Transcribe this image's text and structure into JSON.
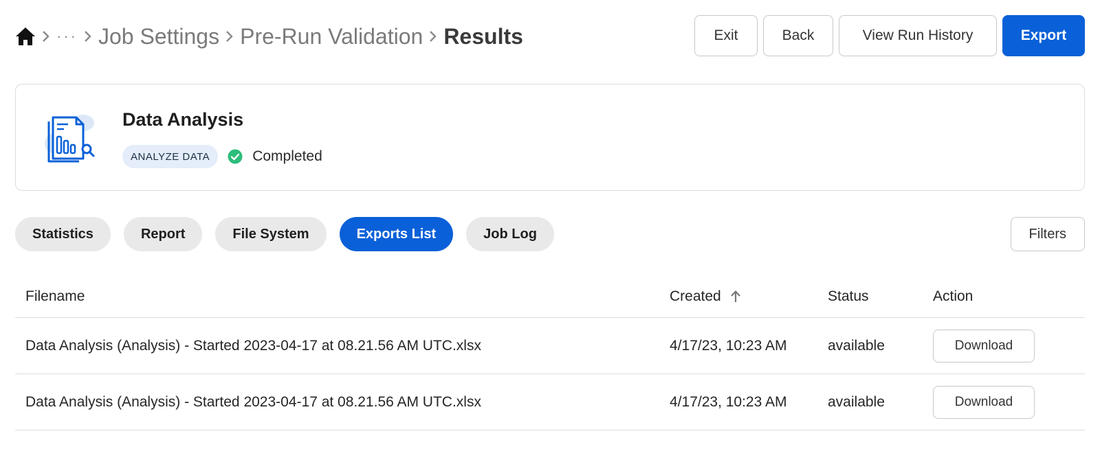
{
  "breadcrumb": {
    "home_icon": "home-icon",
    "ellipsis": "···",
    "items": [
      "Job Settings",
      "Pre-Run Validation"
    ],
    "current": "Results"
  },
  "top_actions": {
    "exit": "Exit",
    "back": "Back",
    "view_run_history": "View Run History",
    "export": "Export"
  },
  "job": {
    "icon": "data-report-icon",
    "title": "Data Analysis",
    "type_tag": "ANALYZE DATA",
    "status_icon": "check-circle-icon",
    "status": "Completed"
  },
  "tabs": [
    {
      "label": "Statistics",
      "active": false
    },
    {
      "label": "Report",
      "active": false
    },
    {
      "label": "File System",
      "active": false
    },
    {
      "label": "Exports List",
      "active": true
    },
    {
      "label": "Job Log",
      "active": false
    }
  ],
  "filters_label": "Filters",
  "table": {
    "columns": {
      "filename": "Filename",
      "created": "Created",
      "status": "Status",
      "action": "Action"
    },
    "sort": {
      "column": "created",
      "direction": "ascending",
      "icon": "arrow-up-icon"
    },
    "rows": [
      {
        "filename": "Data Analysis (Analysis) - Started 2023-04-17 at 08.21.56 AM UTC.xlsx",
        "created": "4/17/23, 10:23 AM",
        "status": "available",
        "action": "Download"
      },
      {
        "filename": "Data Analysis (Analysis) - Started 2023-04-17 at 08.21.56 AM UTC.xlsx",
        "created": "4/17/23, 10:23 AM",
        "status": "available",
        "action": "Download"
      }
    ]
  },
  "colors": {
    "primary": "#0a60d8",
    "tab_inactive": "#e9e9e9",
    "tag_bg": "#e4edf9",
    "success": "#2dbd7a"
  }
}
